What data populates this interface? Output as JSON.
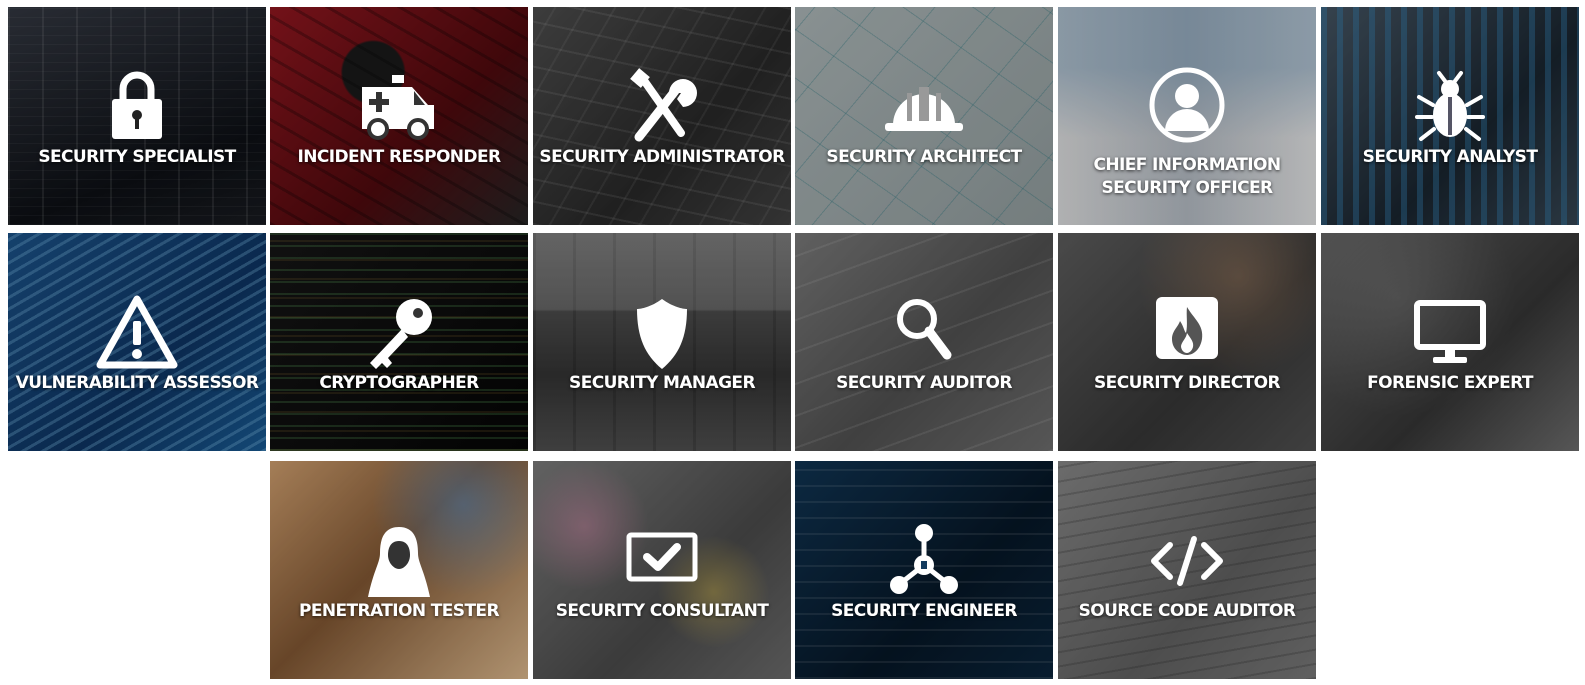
{
  "tiles": [
    {
      "id": "security-specialist",
      "label": "SECURITY SPECIALIST",
      "icon": "padlock-icon"
    },
    {
      "id": "incident-responder",
      "label": "INCIDENT RESPONDER",
      "icon": "ambulance-icon"
    },
    {
      "id": "security-administrator",
      "label": "SECURITY ADMINISTRATOR",
      "icon": "tools-icon"
    },
    {
      "id": "security-architect",
      "label": "SECURITY ARCHITECT",
      "icon": "hard-hat-icon"
    },
    {
      "id": "chief-information-security-officer",
      "label_line1": "CHIEF INFORMATION",
      "label_line2": "SECURITY OFFICER",
      "icon": "user-circle-icon"
    },
    {
      "id": "security-analyst",
      "label": "SECURITY ANALYST",
      "icon": "bug-icon"
    },
    {
      "id": "vulnerability-assessor",
      "label": "VULNERABILITY ASSESSOR",
      "icon": "warning-icon"
    },
    {
      "id": "cryptographer",
      "label": "CRYPTOGRAPHER",
      "icon": "key-icon"
    },
    {
      "id": "security-manager",
      "label": "SECURITY MANAGER",
      "icon": "shield-icon"
    },
    {
      "id": "security-auditor",
      "label": "SECURITY AUDITOR",
      "icon": "magnifier-icon"
    },
    {
      "id": "security-director",
      "label": "SECURITY DIRECTOR",
      "icon": "fire-icon"
    },
    {
      "id": "forensic-expert",
      "label": "FORENSIC EXPERT",
      "icon": "monitor-icon"
    },
    {
      "id": "penetration-tester",
      "label": "PENETRATION TESTER",
      "icon": "hooded-figure-icon"
    },
    {
      "id": "security-consultant",
      "label": "SECURITY CONSULTANT",
      "icon": "checkbox-icon"
    },
    {
      "id": "security-engineer",
      "label": "SECURITY ENGINEER",
      "icon": "network-nodes-icon"
    },
    {
      "id": "source-code-auditor",
      "label": "SOURCE CODE AUDITOR",
      "icon": "code-brackets-icon"
    }
  ],
  "colors": {
    "label": "#ffffff",
    "icon": "#ffffff",
    "page_background": "#ffffff"
  }
}
